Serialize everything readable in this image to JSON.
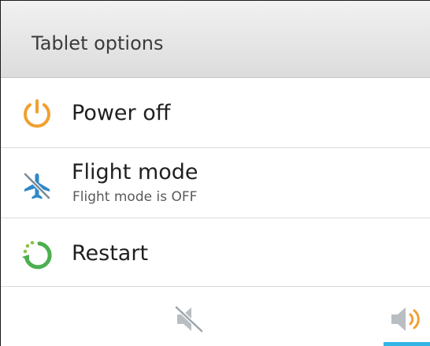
{
  "dialog": {
    "title": "Tablet options"
  },
  "options": [
    {
      "label": "Power off",
      "icon": "power-icon",
      "color": "#f0a030"
    },
    {
      "label": "Flight mode",
      "sublabel": "Flight mode is OFF",
      "icon": "airplane-off-icon",
      "color": "#2e88c8"
    },
    {
      "label": "Restart",
      "icon": "restart-icon",
      "color": "#4caf50"
    }
  ],
  "sound_modes": {
    "items": [
      {
        "icon": "mute-icon",
        "selected": false
      },
      {
        "icon": "speaker-icon",
        "selected": true
      }
    ],
    "accent": "#33b5e5"
  }
}
